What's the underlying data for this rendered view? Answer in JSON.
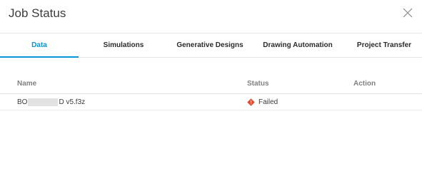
{
  "dialog": {
    "title": "Job Status",
    "close_icon": "close-icon"
  },
  "tabs": [
    {
      "label": "Data",
      "active": true
    },
    {
      "label": "Simulations",
      "active": false
    },
    {
      "label": "Generative Designs",
      "active": false
    },
    {
      "label": "Drawing Automation",
      "active": false
    },
    {
      "label": "Project Transfer",
      "active": false
    }
  ],
  "table": {
    "columns": [
      "Name",
      "Status",
      "Action"
    ],
    "rows": [
      {
        "name_prefix": "BO",
        "name_suffix": "D v5.f3z",
        "status": "Failed",
        "status_icon": "failed-icon",
        "action": ""
      }
    ]
  },
  "colors": {
    "accent": "#0696d7",
    "failed": "#e8482c"
  }
}
